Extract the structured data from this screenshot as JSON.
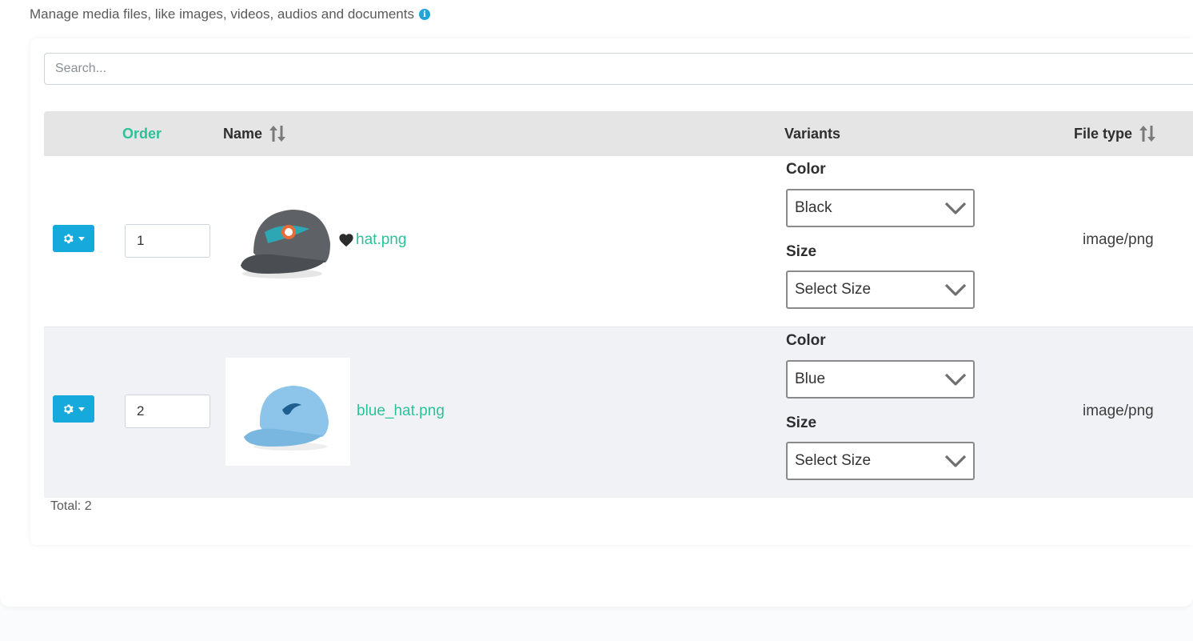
{
  "header": {
    "subtitle": "Manage media files, like images, videos, audios and documents",
    "info_icon": "info-icon"
  },
  "search": {
    "placeholder": "Search..."
  },
  "table": {
    "columns": {
      "order": "Order",
      "name": "Name",
      "variants": "Variants",
      "file_type": "File type"
    },
    "rows": [
      {
        "order": "1",
        "file_name": "hat.png",
        "favorite": true,
        "thumbnail": "dark-grey-cap-with-dolphin-logo",
        "variants": [
          {
            "label": "Color",
            "value": "Black"
          },
          {
            "label": "Size",
            "value": "Select Size"
          }
        ],
        "file_type": "image/png"
      },
      {
        "order": "2",
        "file_name": "blue_hat.png",
        "favorite": false,
        "thumbnail": "light-blue-cap-with-dolphin-logo",
        "variants": [
          {
            "label": "Color",
            "value": "Blue"
          },
          {
            "label": "Size",
            "value": "Select Size"
          }
        ],
        "file_type": "image/png"
      }
    ]
  },
  "footer": {
    "total": "Total: 2"
  },
  "colors": {
    "accent_green": "#2bc29a",
    "button_blue": "#15a9dc",
    "header_bg": "#e5e5e5",
    "alt_row_bg": "#f1f2f6"
  }
}
